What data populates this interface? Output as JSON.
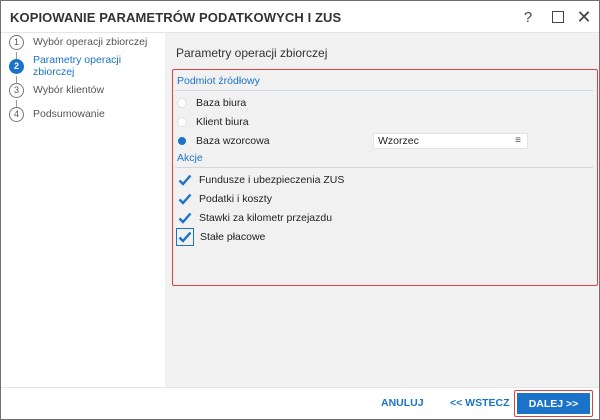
{
  "window": {
    "title": "KOPIOWANIE PARAMETRÓW PODATKOWYCH I ZUS",
    "help_glyph": "?",
    "close_glyph": "✕"
  },
  "steps": [
    {
      "number": "1",
      "label": "Wybór operacji zbiorczej",
      "active": false
    },
    {
      "number": "2",
      "label": "Parametry operacji zbiorczej",
      "active": true
    },
    {
      "number": "3",
      "label": "Wybór klientów",
      "active": false
    },
    {
      "number": "4",
      "label": "Podsumowanie",
      "active": false
    }
  ],
  "content": {
    "title": "Parametry operacji zbiorczej",
    "source_section": {
      "label": "Podmiot źródłowy",
      "options": [
        {
          "label": "Baza biura",
          "selected": false
        },
        {
          "label": "Klient biura",
          "selected": false
        },
        {
          "label": "Baza wzorcowa",
          "selected": true
        }
      ],
      "template_select": {
        "value": "Wzorzec",
        "icon": "menu-icon"
      }
    },
    "actions_section": {
      "label": "Akcje",
      "items": [
        {
          "label": "Fundusze i ubezpieczenia ZUS",
          "checked": true
        },
        {
          "label": "Podatki i koszty",
          "checked": true
        },
        {
          "label": "Stawki za kilometr przejazdu",
          "checked": true
        },
        {
          "label": "Stałe płacowe",
          "checked": true,
          "focused": true
        }
      ]
    }
  },
  "footer": {
    "cancel_label": "ANULUJ",
    "back_label": "<< WSTECZ",
    "next_label": "DALEJ >>"
  },
  "colors": {
    "accent": "#1a73c8",
    "highlight_border": "#d64545",
    "content_bg": "#f1f1f1"
  }
}
